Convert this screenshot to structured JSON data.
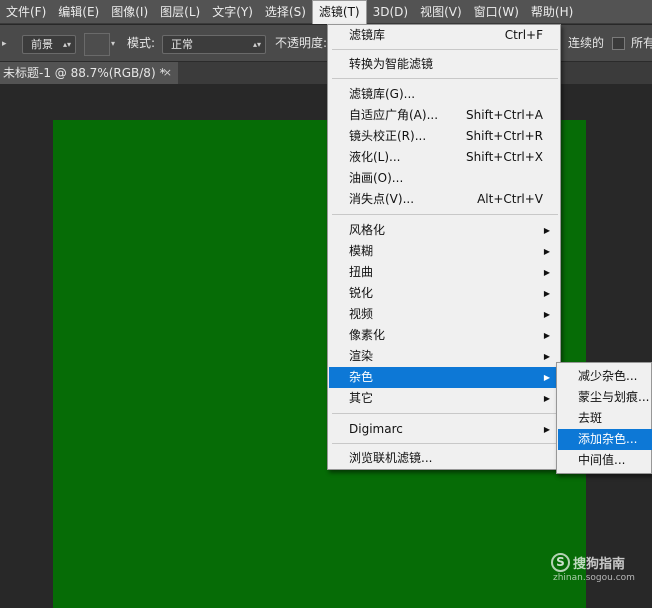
{
  "menubar": {
    "items": [
      "文件(F)",
      "编辑(E)",
      "图像(I)",
      "图层(L)",
      "文字(Y)",
      "选择(S)",
      "滤镜(T)",
      "3D(D)",
      "视图(V)",
      "窗口(W)",
      "帮助(H)"
    ]
  },
  "options": {
    "fill_source": "前景",
    "mode_label": "模式:",
    "mode_value": "正常",
    "opacity_label": "不透明度:",
    "contiguous_label": "连续的",
    "all_layers_label": "所有"
  },
  "document_tab": {
    "title": "未标题-1 @ 88.7%(RGB/8) *",
    "close": "×"
  },
  "canvas": {
    "fill_color": "#066c06"
  },
  "filter_menu": {
    "items": [
      {
        "label": "滤镜库",
        "shortcut": "Ctrl+F"
      },
      {
        "label": "转换为智能滤镜"
      },
      {
        "label": "滤镜库(G)..."
      },
      {
        "label": "自适应广角(A)...",
        "shortcut": "Shift+Ctrl+A"
      },
      {
        "label": "镜头校正(R)...",
        "shortcut": "Shift+Ctrl+R"
      },
      {
        "label": "液化(L)...",
        "shortcut": "Shift+Ctrl+X"
      },
      {
        "label": "油画(O)..."
      },
      {
        "label": "消失点(V)...",
        "shortcut": "Alt+Ctrl+V"
      },
      {
        "label": "风格化"
      },
      {
        "label": "模糊"
      },
      {
        "label": "扭曲"
      },
      {
        "label": "锐化"
      },
      {
        "label": "视频"
      },
      {
        "label": "像素化"
      },
      {
        "label": "渲染"
      },
      {
        "label": "杂色",
        "highlighted": true
      },
      {
        "label": "其它"
      },
      {
        "label": "Digimarc"
      },
      {
        "label": "浏览联机滤镜..."
      }
    ]
  },
  "noise_submenu": {
    "items": [
      {
        "label": "减少杂色..."
      },
      {
        "label": "蒙尘与划痕..."
      },
      {
        "label": "去斑"
      },
      {
        "label": "添加杂色...",
        "highlighted": true
      },
      {
        "label": "中间值..."
      }
    ]
  },
  "watermark": {
    "logo": "S",
    "name": "搜狗指南",
    "url": "zhinan.sogou.com"
  },
  "colors": {
    "menu_highlight": "#0d78d6",
    "menu_bg": "#f0f0f0",
    "ui_bar": "#535353",
    "canvas_green": "#066c06"
  }
}
